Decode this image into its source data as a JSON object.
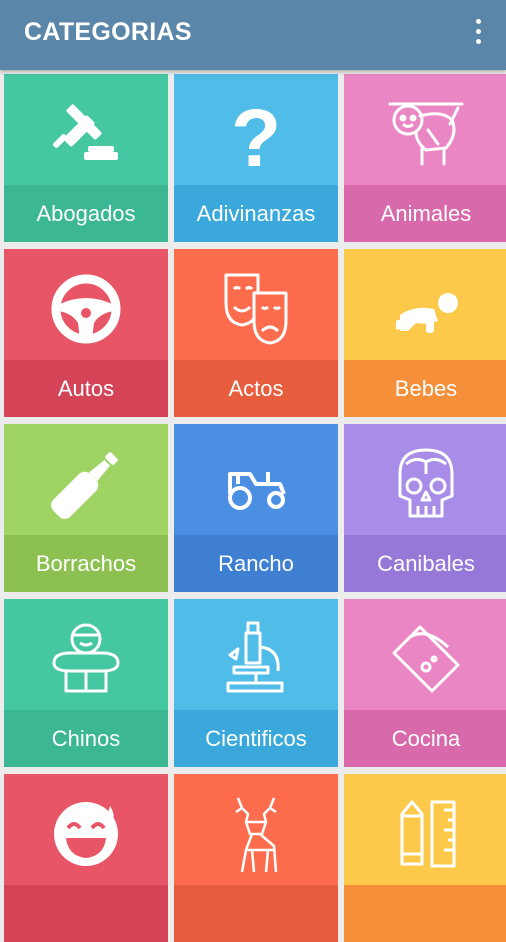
{
  "app_bar": {
    "title": "CATEGORIAS",
    "menu_icon": "overflow-menu-icon"
  },
  "categories": [
    {
      "label": "Abogados",
      "icon": "gavel-icon",
      "color": "#45c7a1",
      "band": "#3bb893"
    },
    {
      "label": "Adivinanzas",
      "icon": "question-mark-icon",
      "color": "#4fbde7",
      "band": "#3aa8db"
    },
    {
      "label": "Animales",
      "icon": "sloth-icon",
      "color": "#ea86c3",
      "band": "#d86aab"
    },
    {
      "label": "Autos",
      "icon": "steering-wheel-icon",
      "color": "#e85566",
      "band": "#d54357"
    },
    {
      "label": "Actos",
      "icon": "theater-masks-icon",
      "color": "#fd6c4d",
      "band": "#e85d3e"
    },
    {
      "label": "Bebes",
      "icon": "crawling-baby-icon",
      "color": "#fdc94b",
      "band": "#f58f3a"
    },
    {
      "label": "Borrachos",
      "icon": "bottle-icon",
      "color": "#9fd464",
      "band": "#8cc051"
    },
    {
      "label": "Rancho",
      "icon": "tractor-icon",
      "color": "#4b8fe3",
      "band": "#3f7fd1"
    },
    {
      "label": "Canibales",
      "icon": "skull-brain-icon",
      "color": "#a78de7",
      "band": "#9678d8"
    },
    {
      "label": "Chinos",
      "icon": "chinese-man-icon",
      "color": "#45c7a1",
      "band": "#3bb893"
    },
    {
      "label": "Cientificos",
      "icon": "microscope-icon",
      "color": "#4fbde7",
      "band": "#3aa8db"
    },
    {
      "label": "Cocina",
      "icon": "cutting-board-icon",
      "color": "#ea86c3",
      "band": "#d86aab"
    },
    {
      "label": "",
      "icon": "laughing-face-icon",
      "color": "#e85566",
      "band": "#d54357"
    },
    {
      "label": "",
      "icon": "deer-icon",
      "color": "#fd6c4d",
      "band": "#e85d3e"
    },
    {
      "label": "",
      "icon": "pencil-ruler-icon",
      "color": "#fdc94b",
      "band": "#f58f3a"
    }
  ]
}
